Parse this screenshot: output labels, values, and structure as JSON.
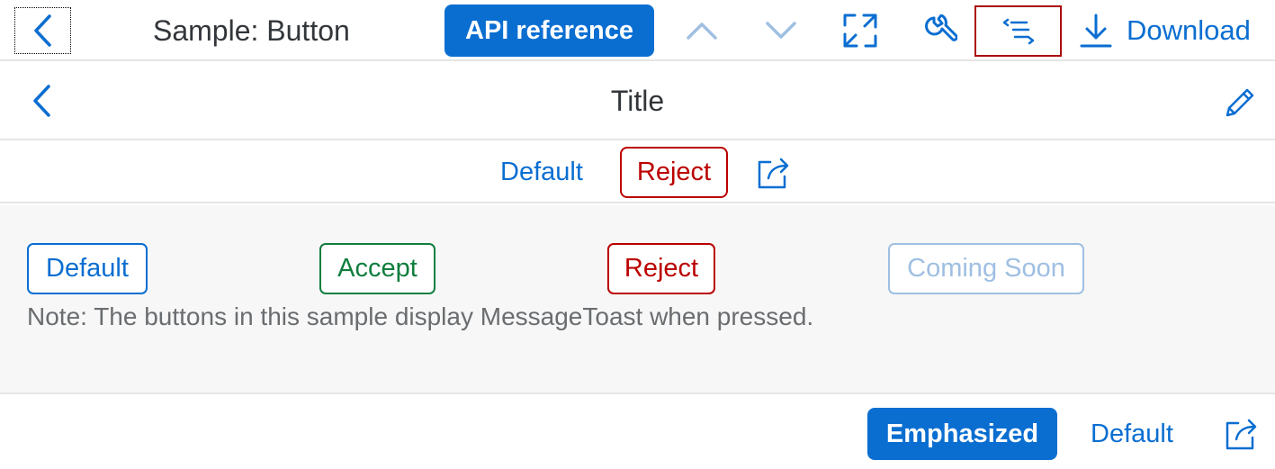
{
  "header": {
    "sample_title": "Sample: Button",
    "api_reference_label": "API reference",
    "download_label": "Download",
    "icons": {
      "back": "chevron-left-icon",
      "up": "chevron-up-icon",
      "down": "chevron-down-icon",
      "fullscreen": "fullscreen-icon",
      "settings": "wrench-icon",
      "code": "code-icon",
      "download": "download-icon"
    }
  },
  "page": {
    "title": "Title",
    "icons": {
      "back": "chevron-left-icon",
      "edit": "pencil-icon"
    }
  },
  "subheader": {
    "default_label": "Default",
    "reject_label": "Reject",
    "share_icon": "share-icon"
  },
  "content": {
    "buttons": [
      {
        "label": "Default",
        "type": "default"
      },
      {
        "label": "Accept",
        "type": "accept"
      },
      {
        "label": "Reject",
        "type": "reject"
      },
      {
        "label": "Coming Soon",
        "type": "disabled"
      }
    ],
    "note": "Note: The buttons in this sample display MessageToast when pressed."
  },
  "footer": {
    "emphasized_label": "Emphasized",
    "default_label": "Default",
    "share_icon": "share-icon"
  },
  "colors": {
    "brand": "#0a6ed1",
    "accept": "#107e3e",
    "reject": "#bb0000",
    "disabled": "#9fbfe2",
    "text": "#32363a",
    "content_bg": "#f7f7f7"
  }
}
